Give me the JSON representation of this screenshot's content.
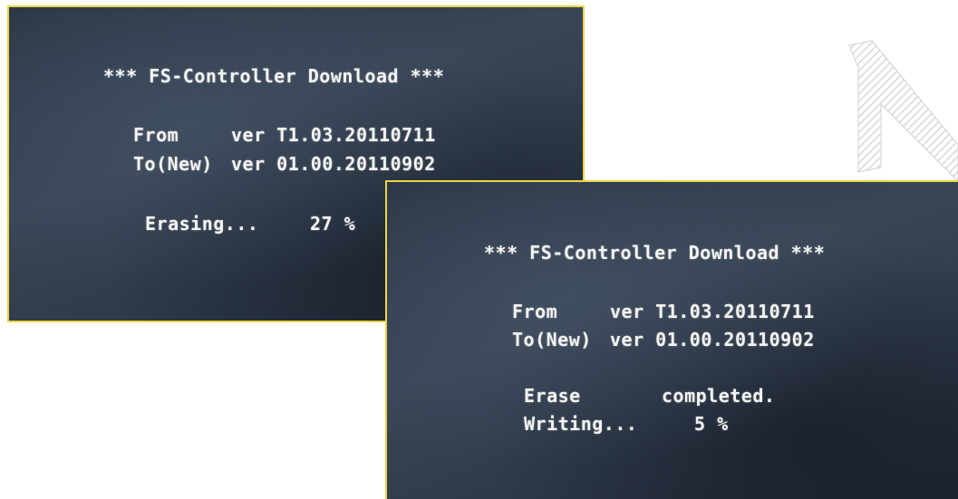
{
  "screens": [
    {
      "title": "*** FS-Controller Download ***",
      "from_label": "From",
      "from_ver": "ver T1.03.20110711",
      "to_label": "To(New)",
      "to_ver": "ver 01.00.20110902",
      "status_label": "Erasing...",
      "status_value": "27 %"
    },
    {
      "title": "*** FS-Controller Download ***",
      "from_label": "From",
      "from_ver": "ver T1.03.20110711",
      "to_label": "To(New)",
      "to_ver": "ver 01.00.20110902",
      "erase_label": "Erase",
      "erase_value": "completed.",
      "writing_label": "Writing...",
      "writing_value": "5 %"
    }
  ]
}
